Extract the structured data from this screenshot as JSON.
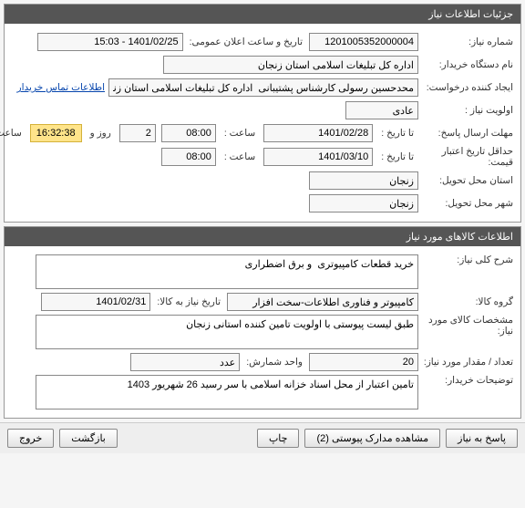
{
  "panels": {
    "need": "جزئیات اطلاعات نیاز",
    "goods": "اطلاعات کالاهای مورد نیاز"
  },
  "need": {
    "number_label": "شماره نیاز:",
    "number": "1201005352000004",
    "announce_label": "تاریخ و ساعت اعلان عمومی:",
    "announce": "1401/02/25 - 15:03",
    "buyer_label": "نام دستگاه خریدار:",
    "buyer": "اداره کل تبلیغات اسلامی استان زنجان",
    "requester_label": "ایجاد کننده درخواست:",
    "requester": "محدحسین رسولی کارشناس پشتیبانی  اداره کل تبلیغات اسلامی استان زنجان",
    "contact_link": "اطلاعات تماس خریدار",
    "priority_label": "اولویت نیاز :",
    "priority": "عادی",
    "deadline_reply_label": "مهلت ارسال پاسخ:",
    "to_date_label": "تا تاریخ :",
    "deadline_reply_date": "1401/02/28",
    "time_label": "ساعت :",
    "deadline_reply_time": "08:00",
    "remain_days": "2",
    "remain_days_label": "روز و",
    "remain_time": "16:32:38",
    "remain_suffix": "ساعت باقی مانده",
    "min_validity_label": "حداقل تاریخ اعتبار قیمت:",
    "min_validity_date": "1401/03/10",
    "min_validity_time": "08:00",
    "delivery_province_label": "استان محل تحویل:",
    "delivery_province": "زنجان",
    "delivery_city_label": "شهر محل تحویل:",
    "delivery_city": "زنجان"
  },
  "goods": {
    "summary_label": "شرح کلی نیاز:",
    "summary": "خرید قطعات کامپیوتری  و برق اضطراری",
    "group_label": "گروه کالا:",
    "group": "کامپیوتر و فناوری اطلاعات-سخت افزار",
    "need_date_label": "تاریخ نیاز به کالا:",
    "need_date": "1401/02/31",
    "spec_label": "مشخصات کالای مورد نیاز:",
    "spec": "طبق لیست پیوستی با اولویت تامین کننده استانی زنجان",
    "qty_label": "تعداد / مقدار مورد نیاز:",
    "qty": "20",
    "unit_label": "واحد شمارش:",
    "unit": "عدد",
    "buyer_note_label": "توضیحات خریدار:",
    "buyer_note": "تامین اعتبار از محل اسناد خزانه اسلامی با سر رسید 26 شهریور 1403"
  },
  "footer": {
    "reply": "پاسخ به نیاز",
    "attach": "مشاهده مدارک پیوستی (2)",
    "print": "چاپ",
    "back": "بازگشت",
    "exit": "خروج"
  }
}
